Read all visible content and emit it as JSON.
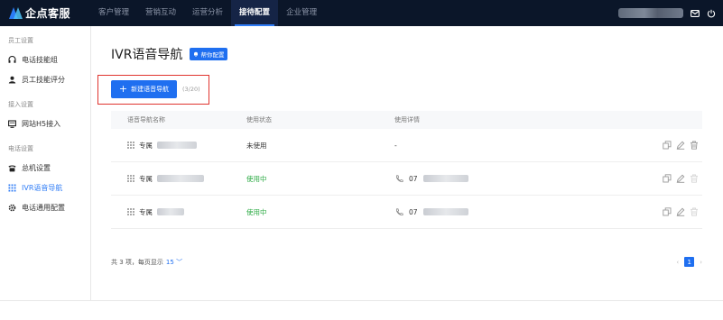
{
  "brand": {
    "name": "企点客服"
  },
  "nav": {
    "items": [
      {
        "label": "客户管理",
        "active": false
      },
      {
        "label": "营销互动",
        "active": false
      },
      {
        "label": "运营分析",
        "active": false
      },
      {
        "label": "接待配置",
        "active": true
      },
      {
        "label": "企业管理",
        "active": false
      }
    ]
  },
  "topbar": {
    "icons": [
      "mail-icon",
      "logout-icon"
    ]
  },
  "sidebar": {
    "groups": [
      {
        "title": "员工设置",
        "items": [
          {
            "label": "电话技能组",
            "icon": "headset-icon"
          },
          {
            "label": "员工技能评分",
            "icon": "users-icon"
          }
        ]
      },
      {
        "title": "接入设置",
        "items": [
          {
            "label": "网站H5接入",
            "icon": "monitor-icon"
          }
        ]
      },
      {
        "title": "电话设置",
        "items": [
          {
            "label": "总机设置",
            "icon": "telephone-icon"
          },
          {
            "label": "IVR语音导航",
            "icon": "grid-icon",
            "active": true
          },
          {
            "label": "电话通用配置",
            "icon": "gear-icon"
          }
        ]
      }
    ]
  },
  "page": {
    "title": "IVR语音导航",
    "help_label": "帮你配置",
    "new_button_label": "新建语音导航",
    "quota": "(3/20)"
  },
  "table": {
    "headers": [
      "语音导航名称",
      "使用状态",
      "使用详情"
    ],
    "rows": [
      {
        "name_prefix": "专属",
        "status": "未使用",
        "status_type": "unused",
        "detail_prefix": "-",
        "has_phone": false
      },
      {
        "name_prefix": "专属",
        "status": "使用中",
        "status_type": "used",
        "detail_prefix": "07",
        "has_phone": true
      },
      {
        "name_prefix": "专属",
        "status": "使用中",
        "status_type": "used",
        "detail_prefix": "07",
        "has_phone": true
      }
    ]
  },
  "footer": {
    "total_text": "共 3 项，每页显示",
    "page_size": "15",
    "current_page": "1"
  },
  "colors": {
    "primary": "#1f6ff0",
    "topbar": "#0b1629",
    "used": "#2dab45",
    "highlight": "#e0342e"
  }
}
